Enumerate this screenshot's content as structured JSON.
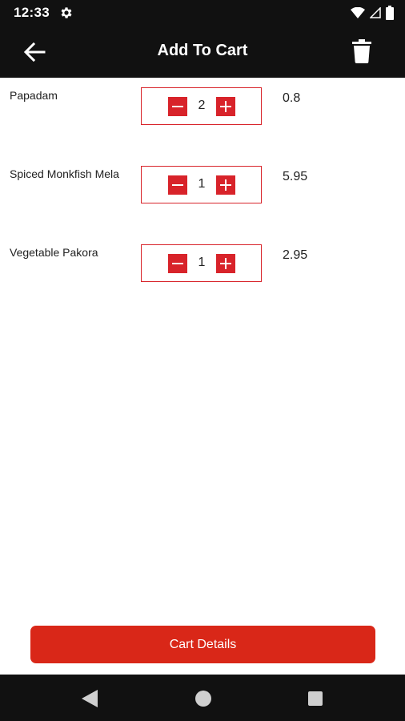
{
  "status_bar": {
    "time": "12:33",
    "icons": [
      "settings-gear-icon",
      "wifi-icon",
      "cellular-signal-icon",
      "battery-icon"
    ]
  },
  "app_bar": {
    "title": "Add To Cart",
    "back_icon": "arrow-left-icon",
    "delete_icon": "trash-icon"
  },
  "cart": {
    "items": [
      {
        "name": "Papadam",
        "quantity": "2",
        "price": "0.8"
      },
      {
        "name": "Spiced Monkfish Mela",
        "quantity": "1",
        "price": "5.95"
      },
      {
        "name": "Vegetable Pakora",
        "quantity": "1",
        "price": "2.95"
      }
    ]
  },
  "footer": {
    "cart_details_label": "Cart Details"
  },
  "nav_bar": {
    "icons": [
      "nav-back-icon",
      "nav-home-icon",
      "nav-recents-icon"
    ]
  },
  "colors": {
    "bar_background": "#111111",
    "accent_red": "#d8232a",
    "button_red": "#d92718"
  }
}
